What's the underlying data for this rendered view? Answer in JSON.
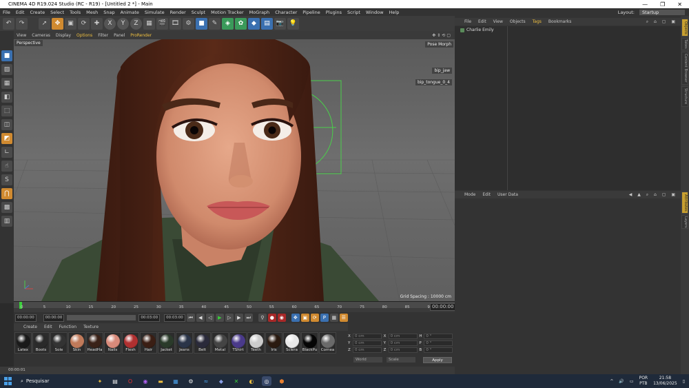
{
  "window": {
    "title": "CINEMA 4D R19.024 Studio (RC - R19) - [Untitled 2 *] - Main"
  },
  "menubar": {
    "items": [
      "File",
      "Edit",
      "Create",
      "Select",
      "Tools",
      "Mesh",
      "Snap",
      "Animate",
      "Simulate",
      "Render",
      "Sculpt",
      "Motion Tracker",
      "MoGraph",
      "Character",
      "Pipeline",
      "Plugins",
      "Script",
      "Window",
      "Help"
    ],
    "layout_label": "Layout:",
    "layout_value": "Startup"
  },
  "viewport": {
    "menu": [
      "View",
      "Cameras",
      "Display",
      "Options",
      "Filter",
      "Panel",
      "ProRender"
    ],
    "name": "Perspective",
    "pose_morph": "Pose Morph",
    "tag_jaw": "bip_jaw",
    "tag_tongue": "bip_tongue_0_4",
    "grid_spacing": "Grid Spacing : 10000 cm"
  },
  "timeline": {
    "ticks": [
      "0",
      "5",
      "10",
      "15",
      "20",
      "25",
      "30",
      "35",
      "40",
      "45",
      "50",
      "55",
      "60",
      "65",
      "70",
      "75",
      "80",
      "85",
      "90"
    ],
    "end_field": "00:00:00",
    "current_frame_field": "00:00:00",
    "start_field": "00:00:00",
    "max_field": "00:03:00",
    "max_field2": "00:03:00"
  },
  "materials": {
    "menu": [
      "Create",
      "Edit",
      "Function",
      "Texture"
    ],
    "items": [
      {
        "name": "Latex",
        "color": "#1a1a1a"
      },
      {
        "name": "Boots",
        "color": "#2a2a2a"
      },
      {
        "name": "Sole",
        "color": "#333333"
      },
      {
        "name": "Skin",
        "color": "#c07a5a"
      },
      {
        "name": "HeadHa",
        "color": "#3a2218"
      },
      {
        "name": "Nails",
        "color": "#d88a7a"
      },
      {
        "name": "Flesh",
        "color": "#b03030"
      },
      {
        "name": "Hair",
        "color": "#3a1e14"
      },
      {
        "name": "Jacket",
        "color": "#2a3a2a"
      },
      {
        "name": "Jeans",
        "color": "#2a3448"
      },
      {
        "name": "Belt",
        "color": "#2a2a3a"
      },
      {
        "name": "Metal",
        "color": "#444444"
      },
      {
        "name": "TShirt",
        "color": "#4a3a8a"
      },
      {
        "name": "Teeth",
        "color": "#cccccc"
      },
      {
        "name": "Iris",
        "color": "#2a1a10"
      },
      {
        "name": "Sclera",
        "color": "#e8e8e8"
      },
      {
        "name": "BlackPu",
        "color": "#050505"
      },
      {
        "name": "Cornea",
        "color": "#6a6a6a"
      }
    ]
  },
  "coordinates": {
    "rows": [
      [
        {
          "axis": "X",
          "value": "0 cm"
        },
        {
          "axis": "X",
          "value": "0 cm"
        },
        {
          "axis": "H",
          "value": "0 °"
        }
      ],
      [
        {
          "axis": "Y",
          "value": "0 cm"
        },
        {
          "axis": "Y",
          "value": "0 cm"
        },
        {
          "axis": "P",
          "value": "0 °"
        }
      ],
      [
        {
          "axis": "Z",
          "value": "0 cm"
        },
        {
          "axis": "Z",
          "value": "0 cm"
        },
        {
          "axis": "B",
          "value": "0 °"
        }
      ]
    ],
    "mode1": "World",
    "mode2": "Scale",
    "apply": "Apply"
  },
  "objects": {
    "menu": [
      "File",
      "Edit",
      "View",
      "Objects",
      "Tags",
      "Bookmarks"
    ],
    "items": [
      "Charlie Emily"
    ]
  },
  "attributes": {
    "menu": [
      "Mode",
      "Edit",
      "User Data"
    ]
  },
  "side_tabs": [
    "Objects",
    "Takes",
    "Content Browser",
    "Structure",
    "Attributes",
    "Layers"
  ],
  "statusbar": {
    "text": "00:00:01"
  },
  "taskbar": {
    "search": "Pesquisar",
    "lang1": "POR",
    "lang2": "PTB",
    "time": "21:58",
    "date": "13/06/2025"
  },
  "colors": {
    "accent": "#f0c040",
    "selection": "#3a70b0"
  }
}
